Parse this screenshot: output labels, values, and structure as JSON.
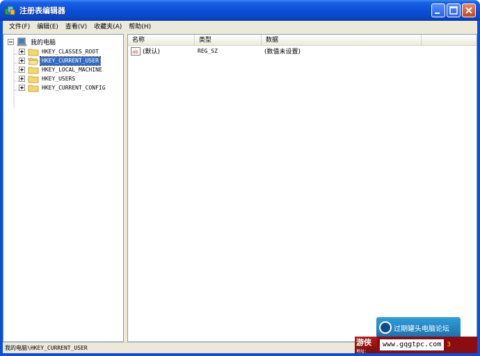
{
  "window": {
    "title": "注册表编辑器",
    "icon": "registry-editor-icon"
  },
  "menu": [
    {
      "label": "文件(F)"
    },
    {
      "label": "编辑(E)"
    },
    {
      "label": "查看(V)"
    },
    {
      "label": "收藏夹(A)"
    },
    {
      "label": "帮助(H)"
    }
  ],
  "tree": {
    "root": "我的电脑",
    "nodes": [
      {
        "label": "HKEY_CLASSES_ROOT",
        "selected": false
      },
      {
        "label": "HKEY_CURRENT_USER",
        "selected": true
      },
      {
        "label": "HKEY_LOCAL_MACHINE",
        "selected": false
      },
      {
        "label": "HKEY_USERS",
        "selected": false
      },
      {
        "label": "HKEY_CURRENT_CONFIG",
        "selected": false
      }
    ]
  },
  "list": {
    "columns": [
      "名称",
      "类型",
      "数据"
    ],
    "rows": [
      {
        "name": "(默认)",
        "type": "REG_SZ",
        "data": "(数值未设置)"
      }
    ]
  },
  "statusbar": {
    "path": "我的电脑\\HKEY_CURRENT_USER"
  },
  "watermark": {
    "forum": "过期罐头电脑论坛",
    "site": "www.gqgtpc.com",
    "brand": "游侠",
    "brand_sub": "地址：",
    "end": "3"
  },
  "colors": {
    "titlebar": "#0a4fd6",
    "selection": "#316ac5",
    "chrome": "#ece9d8"
  }
}
